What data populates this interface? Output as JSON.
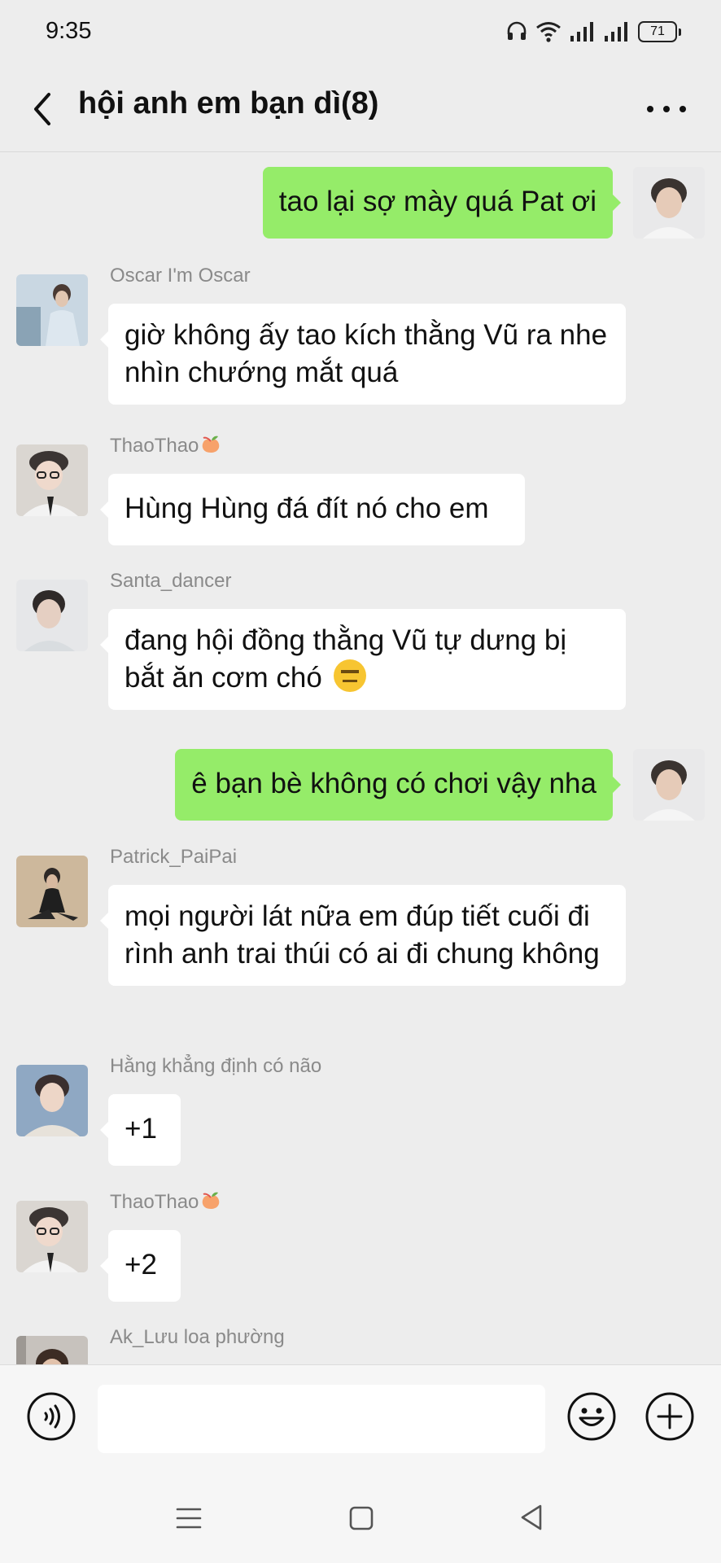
{
  "status_bar": {
    "time": "9:35",
    "battery": "71",
    "icons": [
      "headphones-icon",
      "wifi-icon",
      "signal-icon",
      "signal-icon",
      "battery-icon"
    ]
  },
  "header": {
    "title": "hội anh em bạn dì(8)",
    "back_icon": "chevron-left-icon",
    "more_icon": "more-dots-icon"
  },
  "messages": [
    {
      "side": "out",
      "text": "tao lại sợ mày quá Pat ơi"
    },
    {
      "side": "in",
      "sender": "Oscar I'm Oscar",
      "text": "giờ không ấy tao kích thằng Vũ ra nhe nhìn chướng mắt quá"
    },
    {
      "side": "in",
      "sender": "ThaoThao",
      "sender_emoji": "peach-icon",
      "text": "Hùng Hùng đá đít nó cho em"
    },
    {
      "side": "in",
      "sender": "Santa_dancer",
      "text": "đang hội đồng thằng Vũ tự dưng bị bắt ăn cơm chó",
      "emoji": "expressionless-face-icon"
    },
    {
      "side": "out",
      "text": "ê bạn bè không có chơi vậy nha"
    },
    {
      "side": "in",
      "sender": "Patrick_PaiPai",
      "text": "mọi người lát nữa em đúp tiết cuối đi rình anh trai thúi có ai đi chung không"
    },
    {
      "side": "in",
      "sender": "Hằng khẳng định có não",
      "text": "+1"
    },
    {
      "side": "in",
      "sender": "ThaoThao",
      "sender_emoji": "peach-icon",
      "text": "+2"
    },
    {
      "side": "in",
      "sender": "Ak_Lưu loa phường",
      "text": ""
    }
  ],
  "input_bar": {
    "value": "",
    "icons": [
      "voice-icon",
      "emoji-icon",
      "plus-icon"
    ]
  },
  "nav_bar": {
    "icons": [
      "menu-icon",
      "home-icon",
      "back-triangle-icon"
    ]
  },
  "colors": {
    "background": "#ededed",
    "outgoing_bubble": "#95ec69",
    "incoming_bubble": "#ffffff",
    "sender_name": "#8a8a8a"
  }
}
